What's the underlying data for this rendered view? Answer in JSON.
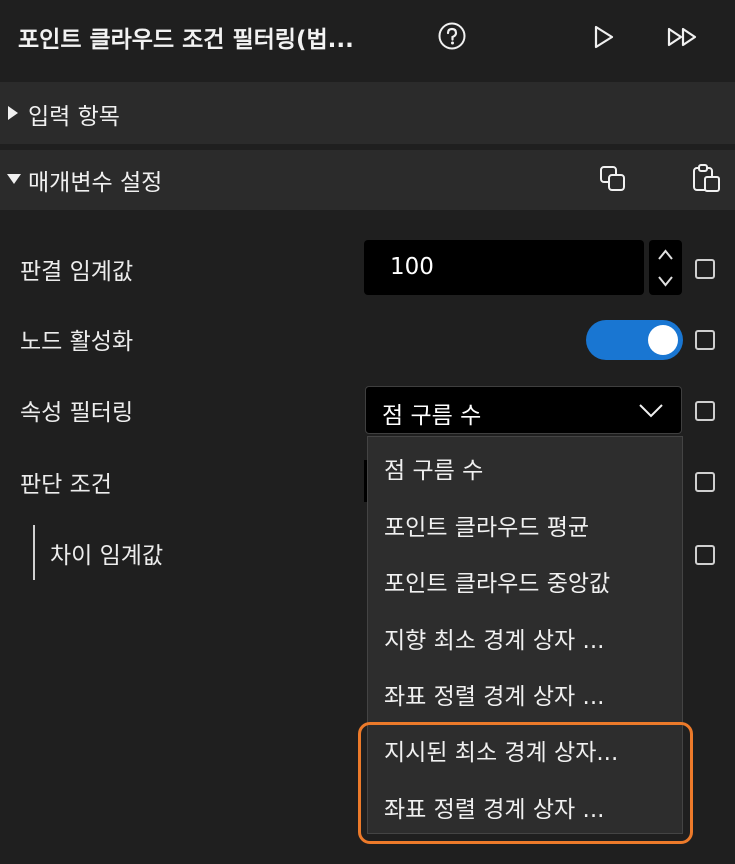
{
  "header": {
    "title": "포인트 클라우드 조건 필터링(법...",
    "help_icon": "help-circle-icon",
    "run_icon": "play-icon",
    "run_all_icon": "fast-forward-icon"
  },
  "sections": {
    "input": {
      "label": "입력 항목",
      "state": "collapsed"
    },
    "params": {
      "label": "매개변수 설정",
      "state": "expanded",
      "copy_icon": "copy-icon",
      "paste_icon": "paste-icon"
    }
  },
  "params": {
    "threshold": {
      "label": "판결 임계값",
      "value": "100"
    },
    "node_active": {
      "label": "노드 활성화",
      "value": true
    },
    "attr_filter": {
      "label": "속성 필터링",
      "selected": "점 구름 수"
    },
    "judge_cond": {
      "label": "판단 조건"
    },
    "diff_threshold": {
      "label": "차이 임계값"
    }
  },
  "dropdown": {
    "options": [
      "점 구름 수",
      "포인트 클라우드 평균",
      "포인트 클라우드 중앙값",
      "지향 최소 경계 상자 ...",
      "좌표 정렬 경계 상자 ...",
      "지시된 최소 경계 상자...",
      "좌표 정렬 경계 상자 ..."
    ]
  },
  "colors": {
    "accent": "#1976d2",
    "highlight": "#ec7a2a",
    "background": "#1f1f1f",
    "section": "#2b2b2b"
  }
}
